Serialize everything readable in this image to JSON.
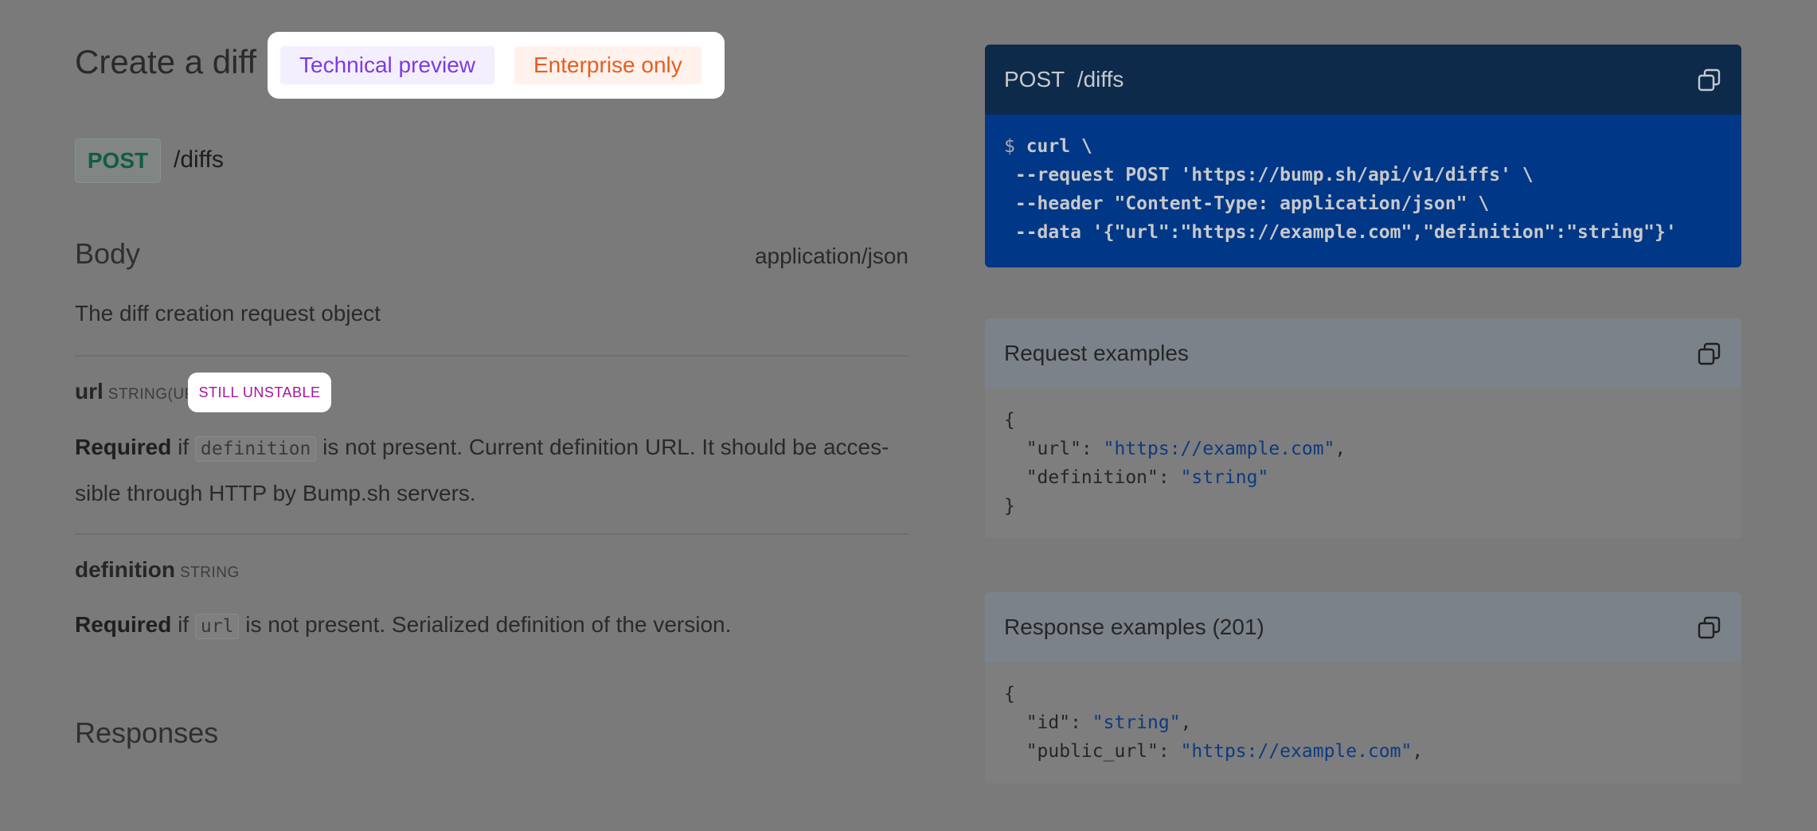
{
  "endpoint": {
    "title": "Create a diff",
    "badges": {
      "preview": "Technical preview",
      "enterprise": "Enterprise only"
    },
    "method": "POST",
    "path": "/diffs"
  },
  "body": {
    "heading": "Body",
    "content_type": "application/json",
    "description": "The diff creation request object"
  },
  "params": [
    {
      "name": "url",
      "type": "STRING(UR",
      "badge": "STILL UNSTABLE",
      "required_label": "Required",
      "if_text": " if ",
      "condition_code": "definition",
      "description_line1": " is not present. Current definition URL. It should be acces-",
      "description_line2": "sible through HTTP by Bump.sh servers."
    },
    {
      "name": "definition",
      "type": "STRING",
      "required_label": "Required",
      "if_text": " if ",
      "condition_code": "url",
      "description": " is not present. Serialized definition of the version."
    }
  ],
  "responses": {
    "heading": "Responses"
  },
  "curl_panel": {
    "method": "POST",
    "path": "/diffs",
    "prompt": "$",
    "line1": " curl \\",
    "line2": " --request POST 'https://bump.sh/api/v1/diffs' \\",
    "line3": " --header \"Content-Type: application/json\" \\",
    "line4": " --data '{\"url\":\"https://example.com\",\"definition\":\"string\"}'"
  },
  "request_examples": {
    "title": "Request examples",
    "open": "{",
    "key1": "  \"url\": ",
    "val1": "\"https://example.com\"",
    "comma1": ",",
    "key2": "  \"definition\": ",
    "val2": "\"string\"",
    "close": "}"
  },
  "response_examples": {
    "title": "Response examples (201)",
    "open": "{",
    "key1": "  \"id\": ",
    "val1": "\"string\"",
    "comma1": ",",
    "key2": "  \"public_url\": ",
    "val2": "\"https://example.com\"",
    "comma2": ","
  },
  "icons": {
    "copy": "copy-icon"
  },
  "colors": {
    "overlay_gray": "#7a7a7a",
    "preview_purple": "#7d3be0",
    "enterprise_orange": "#ea5c1f",
    "post_green": "#0f5e3f",
    "unstable_magenta": "#a5169a",
    "curl_header_bg": "#0e2a4a",
    "curl_body_bg": "#003786",
    "json_string_blue": "#0d3a80"
  }
}
